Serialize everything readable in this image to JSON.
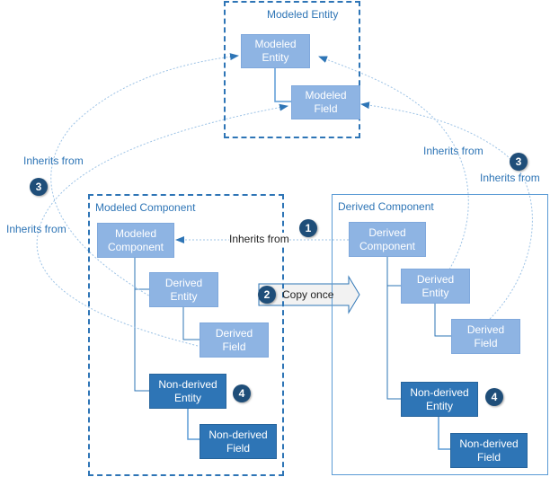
{
  "containers": {
    "modeled_entity": {
      "title": "Modeled Entity"
    },
    "modeled_component": {
      "title": "Modeled Component"
    },
    "derived_component": {
      "title": "Derived Component"
    }
  },
  "nodes": {
    "me_entity": {
      "line1": "Modeled",
      "line2": "Entity"
    },
    "me_field": {
      "line1": "Modeled",
      "line2": "Field"
    },
    "mc_component": {
      "line1": "Modeled",
      "line2": "Component"
    },
    "mc_derived_entity": {
      "line1": "Derived",
      "line2": "Entity"
    },
    "mc_derived_field": {
      "line1": "Derived",
      "line2": "Field"
    },
    "mc_nonderived_entity": {
      "line1": "Non-derived",
      "line2": "Entity"
    },
    "mc_nonderived_field": {
      "line1": "Non-derived",
      "line2": "Field"
    },
    "dc_component": {
      "line1": "Derived",
      "line2": "Component"
    },
    "dc_derived_entity": {
      "line1": "Derived",
      "line2": "Entity"
    },
    "dc_derived_field": {
      "line1": "Derived",
      "line2": "Field"
    },
    "dc_nonderived_entity": {
      "line1": "Non-derived",
      "line2": "Entity"
    },
    "dc_nonderived_field": {
      "line1": "Non-derived",
      "line2": "Field"
    }
  },
  "labels": {
    "inherits_center": "Inherits from",
    "inherits_left_top": "Inherits from",
    "inherits_left_bottom": "Inherits from",
    "inherits_right_mid": "Inherits from",
    "inherits_right_far": "Inherits from",
    "copy_once": "Copy once"
  },
  "badges": {
    "one": "1",
    "two": "2",
    "three_left": "3",
    "three_right": "3",
    "four_left": "4",
    "four_right": "4"
  },
  "colors": {
    "light_node": "#8eb4e3",
    "dark_node": "#2e75b6",
    "badge": "#1f4e79",
    "container_border": "#2e75b6",
    "text_blue": "#2e75b6"
  }
}
